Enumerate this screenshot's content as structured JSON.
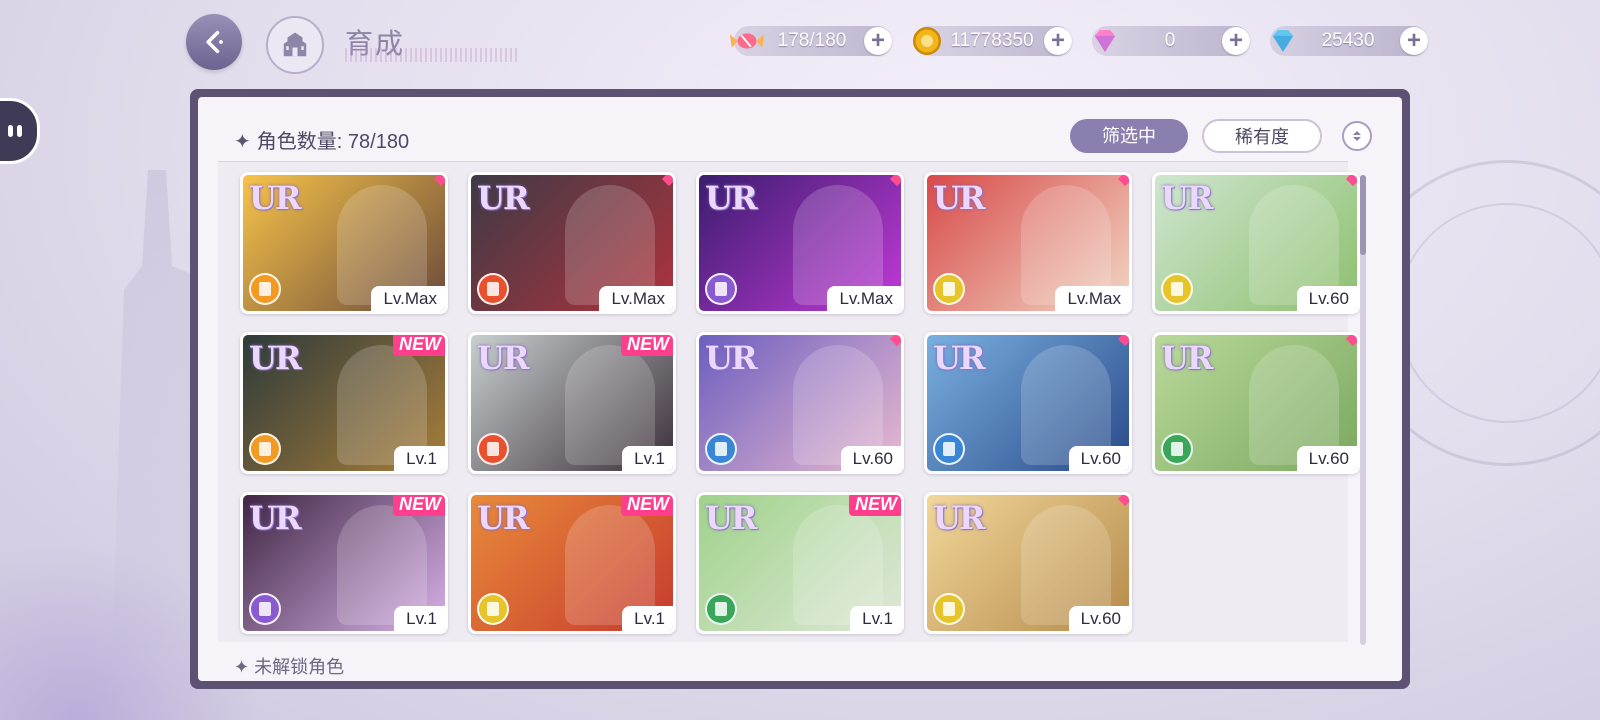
{
  "header": {
    "title": "育成",
    "currencies": [
      {
        "icon": "candy-icon",
        "value": "178/180",
        "color": "#ff6a8a"
      },
      {
        "icon": "gold-coin-icon",
        "value": "11778350",
        "color": "#f2b61a"
      },
      {
        "icon": "pink-diamond-icon",
        "value": "0",
        "color": "#ff7fc8"
      },
      {
        "icon": "blue-diamond-icon",
        "value": "25430",
        "color": "#62c6f2"
      }
    ]
  },
  "panel": {
    "count_label": "角色数量:",
    "count_value": "78/180",
    "filter_label": "筛选中",
    "rarity_label": "稀有度",
    "unlock_label": "未解锁角色"
  },
  "cards": [
    {
      "rarity": "UR",
      "level": "Lv.Max",
      "badge": "dot",
      "element": "orange",
      "bg": [
        "#f7c34a",
        "#6b4a3a"
      ]
    },
    {
      "rarity": "UR",
      "level": "Lv.Max",
      "badge": "dot",
      "element": "red",
      "bg": [
        "#3d3a46",
        "#b0333c"
      ]
    },
    {
      "rarity": "UR",
      "level": "Lv.Max",
      "badge": "dot",
      "element": "purple",
      "bg": [
        "#3b1d6e",
        "#c23ad8"
      ]
    },
    {
      "rarity": "UR",
      "level": "Lv.Max",
      "badge": "dot",
      "element": "yellow",
      "bg": [
        "#d84a4a",
        "#f1d7c4"
      ]
    },
    {
      "rarity": "UR",
      "level": "Lv.60",
      "badge": "dot",
      "element": "yellow",
      "bg": [
        "#cfe6d0",
        "#8cbf6d"
      ]
    },
    {
      "rarity": "UR",
      "level": "Lv.1",
      "badge": "NEW",
      "element": "orange",
      "bg": [
        "#2e3b3a",
        "#a97e3a"
      ]
    },
    {
      "rarity": "UR",
      "level": "Lv.1",
      "badge": "NEW",
      "element": "red",
      "bg": [
        "#c7cfcf",
        "#3c2f3a"
      ]
    },
    {
      "rarity": "UR",
      "level": "Lv.60",
      "badge": "dot",
      "element": "blue",
      "bg": [
        "#6c5fbf",
        "#e9b9d0"
      ]
    },
    {
      "rarity": "UR",
      "level": "Lv.60",
      "badge": "dot",
      "element": "blue",
      "bg": [
        "#7ab0e0",
        "#294a8a"
      ]
    },
    {
      "rarity": "UR",
      "level": "Lv.60",
      "badge": "dot",
      "element": "green",
      "bg": [
        "#b9d99a",
        "#7aa860"
      ]
    },
    {
      "rarity": "UR",
      "level": "Lv.1",
      "badge": "NEW",
      "element": "purple",
      "bg": [
        "#402744",
        "#d8b1e8"
      ]
    },
    {
      "rarity": "UR",
      "level": "Lv.1",
      "badge": "NEW",
      "element": "yellow",
      "bg": [
        "#e88a3a",
        "#c73a2e"
      ]
    },
    {
      "rarity": "UR",
      "level": "Lv.1",
      "badge": "NEW",
      "element": "green",
      "bg": [
        "#9fd28a",
        "#dfe8d8"
      ]
    },
    {
      "rarity": "UR",
      "level": "Lv.60",
      "badge": "dot",
      "element": "yellow",
      "bg": [
        "#f1d79a",
        "#b58a4a"
      ]
    }
  ],
  "element_colors": {
    "orange": "#f29a24",
    "red": "#e8502e",
    "purple": "#8a5ad0",
    "yellow": "#e7c52a",
    "blue": "#3a86d6",
    "green": "#3aa65a"
  }
}
